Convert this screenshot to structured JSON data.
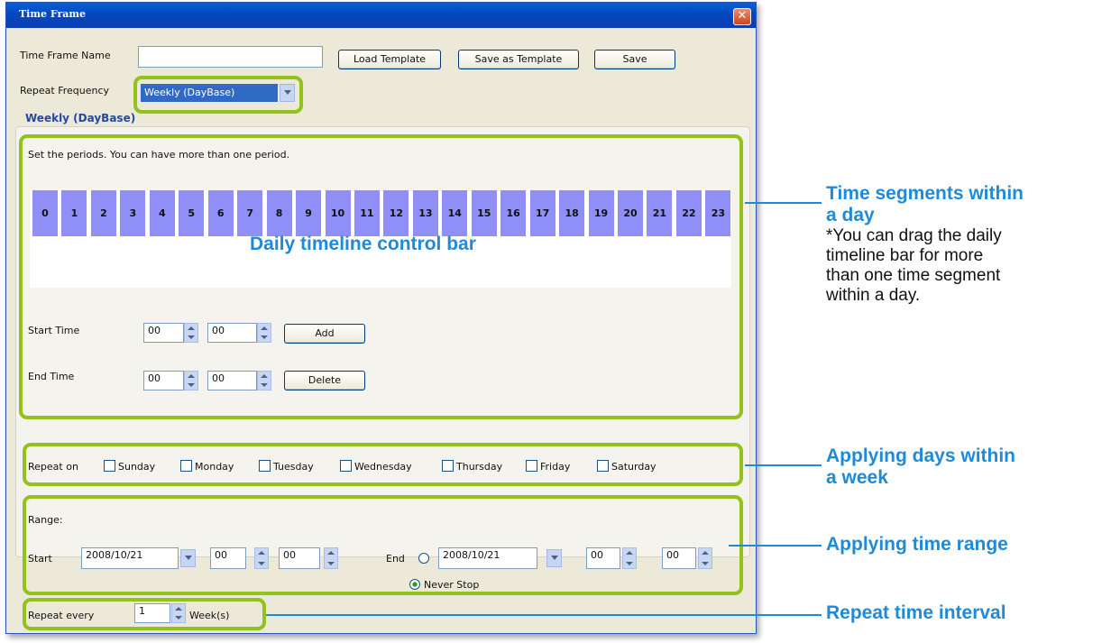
{
  "window": {
    "title": "Time Frame",
    "close_glyph": "✕"
  },
  "top": {
    "name_label": "Time Frame Name",
    "name_value": "",
    "load_template": "Load Template",
    "save_as_template": "Save as Template",
    "save": "Save",
    "repeat_label": "Repeat Frequency",
    "repeat_value": "Weekly (DayBase)"
  },
  "section_title": "Weekly (DayBase)",
  "periods": {
    "instruction": "Set the periods. You can have more than one period.",
    "hours": [
      "0",
      "1",
      "2",
      "3",
      "4",
      "5",
      "6",
      "7",
      "8",
      "9",
      "10",
      "11",
      "12",
      "13",
      "14",
      "15",
      "16",
      "17",
      "18",
      "19",
      "20",
      "21",
      "22",
      "23"
    ],
    "bar_caption": "Daily timeline control bar",
    "start_label": "Start Time",
    "start_h": "00",
    "start_m": "00",
    "end_label": "End Time",
    "end_h": "00",
    "end_m": "00",
    "add": "Add",
    "delete": "Delete"
  },
  "repeat_on": {
    "label": "Repeat on",
    "days": [
      "Sunday",
      "Monday",
      "Tuesday",
      "Wednesday",
      "Thursday",
      "Friday",
      "Saturday"
    ]
  },
  "range": {
    "label": "Range:",
    "start_label": "Start",
    "start_date": "2008/10/21",
    "start_h": "00",
    "start_m": "00",
    "end_label": "End",
    "end_date": "2008/10/21",
    "end_h": "00",
    "end_m": "00",
    "never_stop": "Never Stop"
  },
  "repeat_every": {
    "label": "Repeat every",
    "value": "1",
    "unit": "Week(s)"
  },
  "annotations": {
    "segments_title_1": "Time segments within",
    "segments_title_2": "a day",
    "segments_note_1": "*You can drag the daily",
    "segments_note_2": "timeline bar for more",
    "segments_note_3": "than one time segment",
    "segments_note_4": "within a day.",
    "days_title_1": "Applying days within",
    "days_title_2": "a week",
    "range_title": "Applying time range",
    "interval_title": "Repeat time interval"
  },
  "colors": {
    "accent_green": "#92c21b",
    "annotation_blue": "#1e8ad8",
    "hour_cell": "#8f8ff7",
    "titlebar": "#0348c0"
  }
}
